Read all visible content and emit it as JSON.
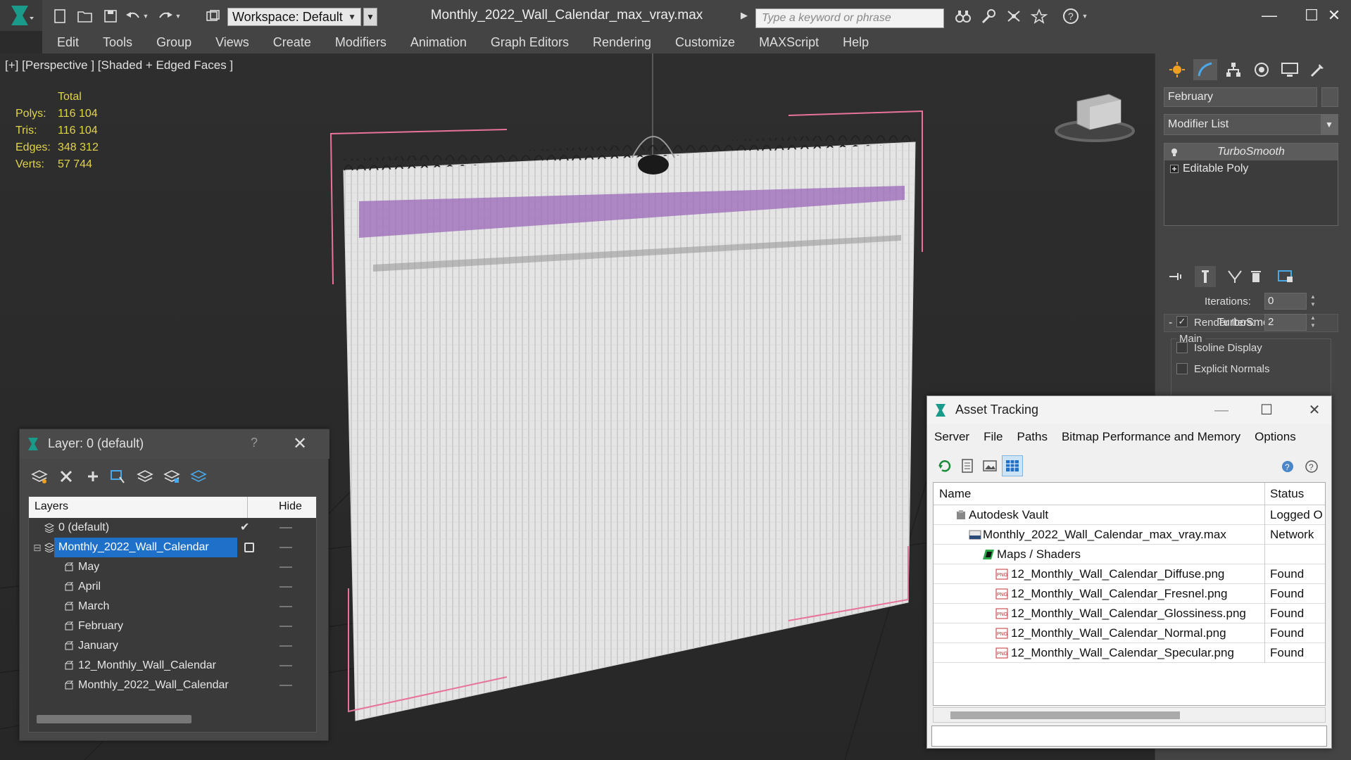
{
  "app": {
    "workspace_label": "Workspace: Default",
    "document_title": "Monthly_2022_Wall_Calendar_max_vray.max",
    "search_placeholder": "Type a keyword or phrase"
  },
  "menu": [
    "Edit",
    "Tools",
    "Group",
    "Views",
    "Create",
    "Modifiers",
    "Animation",
    "Graph Editors",
    "Rendering",
    "Customize",
    "MAXScript",
    "Help"
  ],
  "viewport": {
    "label": "[+] [Perspective ] [Shaded + Edged Faces ]",
    "stats_header": "Total",
    "stats": [
      {
        "label": "Polys:",
        "value": "116 104"
      },
      {
        "label": "Tris:",
        "value": "116 104"
      },
      {
        "label": "Edges:",
        "value": "348 312"
      },
      {
        "label": "Verts:",
        "value": "57 744"
      }
    ]
  },
  "command_panel": {
    "object_name": "February",
    "modifier_list": "Modifier List",
    "stack": [
      "TurboSmooth",
      "Editable Poly"
    ],
    "rollout_title": "TurboSmooth",
    "group_main": "Main",
    "iterations_label": "Iterations:",
    "iterations_value": "0",
    "render_iters_label": "Render Iters:",
    "render_iters_value": "2",
    "isoline_label": "Isoline Display",
    "explicit_normals_label": "Explicit Normals"
  },
  "layer_dialog": {
    "title": "Layer: 0 (default)",
    "help": "?",
    "col_layers": "Layers",
    "col_hide": "Hide",
    "rows": [
      {
        "name": "0 (default)"
      },
      {
        "name": "Monthly_2022_Wall_Calendar"
      },
      {
        "name": "May"
      },
      {
        "name": "April"
      },
      {
        "name": "March"
      },
      {
        "name": "February"
      },
      {
        "name": "January"
      },
      {
        "name": "12_Monthly_Wall_Calendar"
      },
      {
        "name": "Monthly_2022_Wall_Calendar"
      }
    ]
  },
  "asset_dialog": {
    "title": "Asset Tracking",
    "menu": [
      "Server",
      "File",
      "Paths",
      "Bitmap Performance and Memory",
      "Options"
    ],
    "col_name": "Name",
    "col_status": "Status",
    "rows": [
      {
        "name": "Autodesk Vault",
        "status": "Logged O"
      },
      {
        "name": "Monthly_2022_Wall_Calendar_max_vray.max",
        "status": "Network"
      },
      {
        "name": "Maps / Shaders",
        "status": ""
      },
      {
        "name": "12_Monthly_Wall_Calendar_Diffuse.png",
        "status": "Found"
      },
      {
        "name": "12_Monthly_Wall_Calendar_Fresnel.png",
        "status": "Found"
      },
      {
        "name": "12_Monthly_Wall_Calendar_Glossiness.png",
        "status": "Found"
      },
      {
        "name": "12_Monthly_Wall_Calendar_Normal.png",
        "status": "Found"
      },
      {
        "name": "12_Monthly_Wall_Calendar_Specular.png",
        "status": "Found"
      }
    ]
  }
}
